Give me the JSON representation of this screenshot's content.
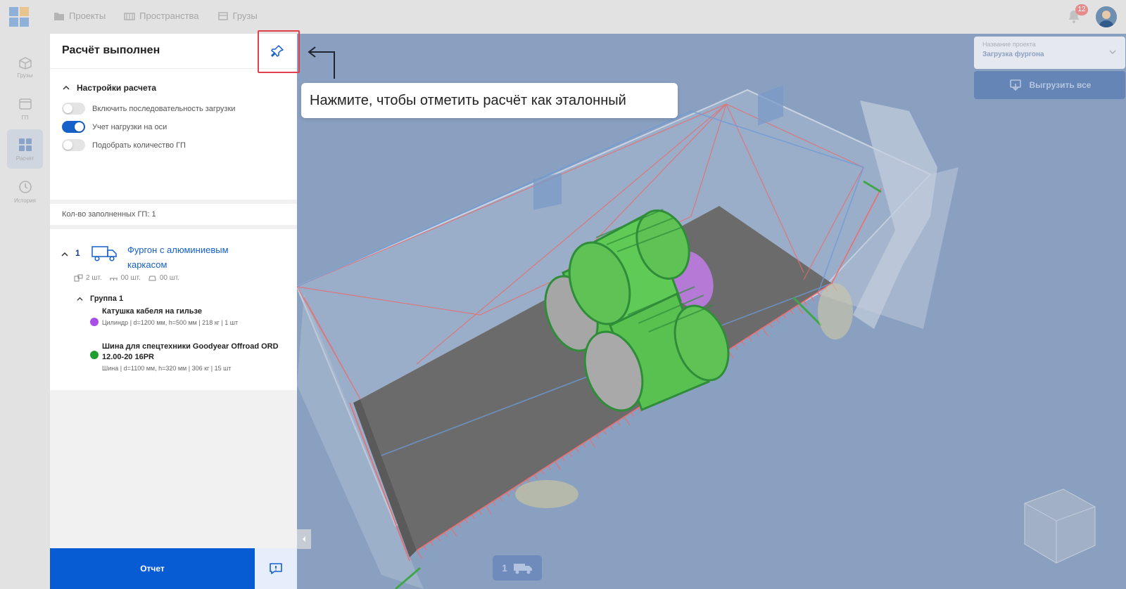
{
  "topbar": {
    "nav": [
      {
        "label": "Проекты",
        "icon": "folder-icon"
      },
      {
        "label": "Пространства",
        "icon": "container-icon"
      },
      {
        "label": "Грузы",
        "icon": "box-icon"
      }
    ],
    "notifications_count": "12"
  },
  "rail": {
    "items": [
      {
        "label": "Грузы",
        "icon": "boxes-icon",
        "active": false
      },
      {
        "label": "ГП",
        "icon": "vehicle-space-icon",
        "active": false
      },
      {
        "label": "Расчет",
        "icon": "grid-icon",
        "active": true
      },
      {
        "label": "История",
        "icon": "clock-icon",
        "active": false
      }
    ]
  },
  "panel": {
    "title": "Расчёт выполнен",
    "settings_title": "Настройки расчета",
    "toggles": [
      {
        "label": "Включить последовательность загрузки",
        "on": false
      },
      {
        "label": "Учет нагрузки на оси",
        "on": true
      },
      {
        "label": "Подобрать количество ГП",
        "on": false
      }
    ],
    "filled_count": "Кол-во заполненных ГП: 1",
    "vehicle": {
      "number": "1",
      "name": "Фургон с алюминиевым каркасом",
      "stats": [
        "2 шт.",
        "00 шт.",
        "00 шт."
      ],
      "group": "Группа 1",
      "cargo": [
        {
          "name": "Катушка кабеля на гильзе",
          "desc": "Цилиндр | d=1200 мм, h=500 мм | 218 кг | 1 шт",
          "color": "#a84ee8"
        },
        {
          "name": "Шина для спецтехники Goodyear Offroad ORD 12.00-20 16PR",
          "desc": "Шина | d=1100 мм, h=320 мм | 306 кг | 15 шт",
          "color": "#1f9e2e"
        }
      ]
    },
    "report_label": "Отчет"
  },
  "viewport": {
    "project_label": "Название проекта",
    "project_value": "Загрузка фургона",
    "unload_label": "Выгрузить все",
    "vehicle_badge": "1"
  },
  "tutorial": {
    "tooltip": "Нажмите, чтобы отметить расчёт как эталонный"
  },
  "colors": {
    "primary": "#075bd3",
    "link": "#1560c9",
    "highlight": "#e0414b",
    "viewport_bg": "#8aa0c0"
  }
}
